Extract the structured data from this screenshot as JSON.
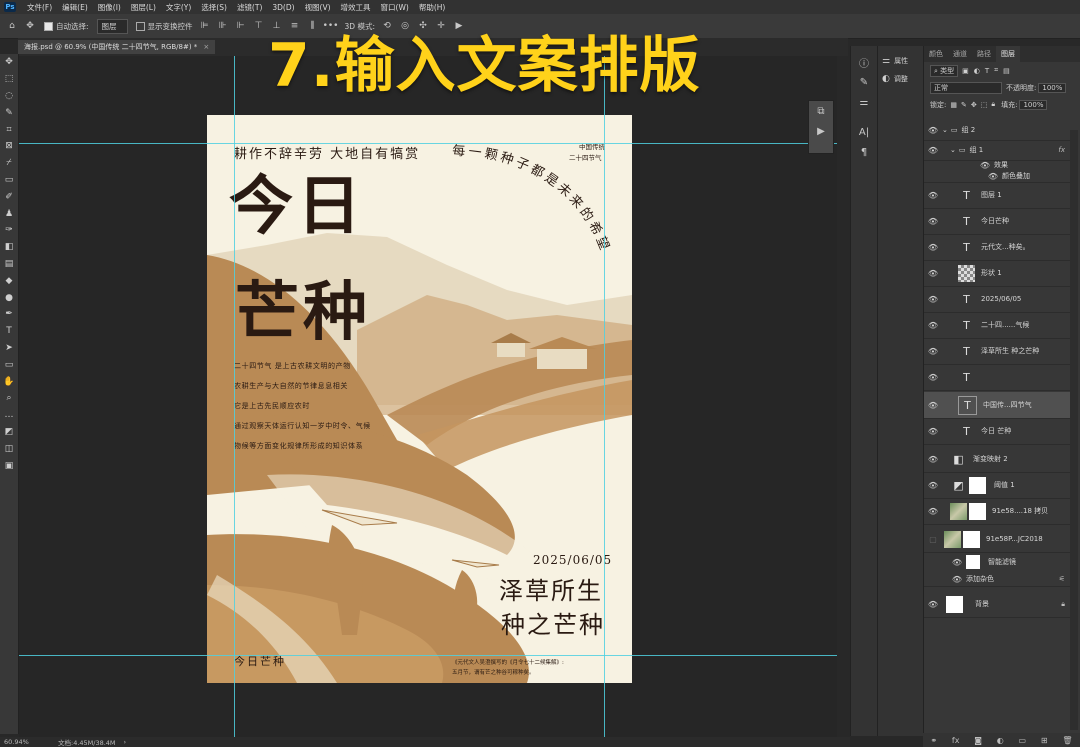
{
  "menubar": {
    "logo": "Ps",
    "items": [
      "文件(F)",
      "编辑(E)",
      "图像(I)",
      "图层(L)",
      "文字(Y)",
      "选择(S)",
      "滤镜(T)",
      "3D(D)",
      "视图(V)",
      "增效工具",
      "窗口(W)",
      "帮助(H)"
    ]
  },
  "options": {
    "auto_select_label": "自动选择:",
    "auto_select_value": "图层",
    "transform_label": "显示变换控件",
    "mode_3d_label": "3D 模式:"
  },
  "document_tab": {
    "title": "海报.psd @ 60.9% (中国传统 二十四节气, RGB/8#) *",
    "close": "×"
  },
  "overlay_title": "7.输入文案排版",
  "poster": {
    "top_line": "耕作不辞辛劳  大地自有犒赏",
    "arc_text": "每一颗种子都是未来的希望",
    "corner_line1": "中国传统",
    "corner_line2": "二十四节气",
    "title_line1": "今日",
    "title_line2": "芒种",
    "body_lines": [
      "二十四节气 是上古农耕文明的产物",
      "农耕生产与大自然的节律息息相关",
      "它是上古先民顺应农时",
      "通过观察天体运行认知一岁中时令、气候",
      "物候等方面变化规律所形成的知识体系"
    ],
    "date": "2025/06/05",
    "slogan_line1": "泽草所生",
    "slogan_line2": "种之芒种",
    "footer_left": "今日芒种",
    "footer_small1": "《元代文人吴澄撰写的《月令七十二候集解》:",
    "footer_small2": "五月节，谓有芒之种谷可稼种矣。"
  },
  "mini_panel": {
    "icon1": "history-icon",
    "icon2": "play-icon"
  },
  "dock": {
    "properties_label": "属性",
    "adjust_label": "调整"
  },
  "layers_panel": {
    "tabs": [
      "颜色",
      "通道",
      "路径",
      "图层"
    ],
    "active_tab": "图层",
    "filter_kind": "类型",
    "blend_mode": "正常",
    "opacity_label": "不透明度:",
    "opacity_value": "100%",
    "lock_label": "锁定:",
    "fill_label": "填充:",
    "fill_value": "100%",
    "layers": [
      {
        "name": "组 2",
        "type": "group"
      },
      {
        "name": "组 1",
        "type": "group",
        "fx": "fx"
      },
      {
        "name": "效果",
        "type": "effect"
      },
      {
        "name": "颜色叠加",
        "type": "effect"
      },
      {
        "name": "图层 1",
        "type": "text"
      },
      {
        "name": "今日芒种",
        "type": "text"
      },
      {
        "name": "元代文...种矣。",
        "type": "text"
      },
      {
        "name": "形状 1",
        "type": "shape"
      },
      {
        "name": "2025/06/05",
        "type": "text"
      },
      {
        "name": "二十四......气候",
        "type": "text"
      },
      {
        "name": "泽草所生 种之芒种",
        "type": "text"
      },
      {
        "name": "",
        "type": "text"
      },
      {
        "name": "中国传...四节气",
        "type": "text",
        "selected": true
      },
      {
        "name": "今日 芒种",
        "type": "text"
      },
      {
        "name": "渐变映射 2",
        "type": "adjust"
      },
      {
        "name": "阈值 1",
        "type": "adjust"
      },
      {
        "name": "91e58....18 拷贝",
        "type": "photo"
      },
      {
        "name": "91e58P...JC2018",
        "type": "photo"
      },
      {
        "name": "智能滤镜",
        "type": "filter"
      },
      {
        "name": "添加杂色",
        "type": "filter"
      },
      {
        "name": "背景",
        "type": "background"
      }
    ]
  },
  "status": {
    "zoom": "60.94%",
    "doc_size": "文档:4.45M/38.4M"
  }
}
